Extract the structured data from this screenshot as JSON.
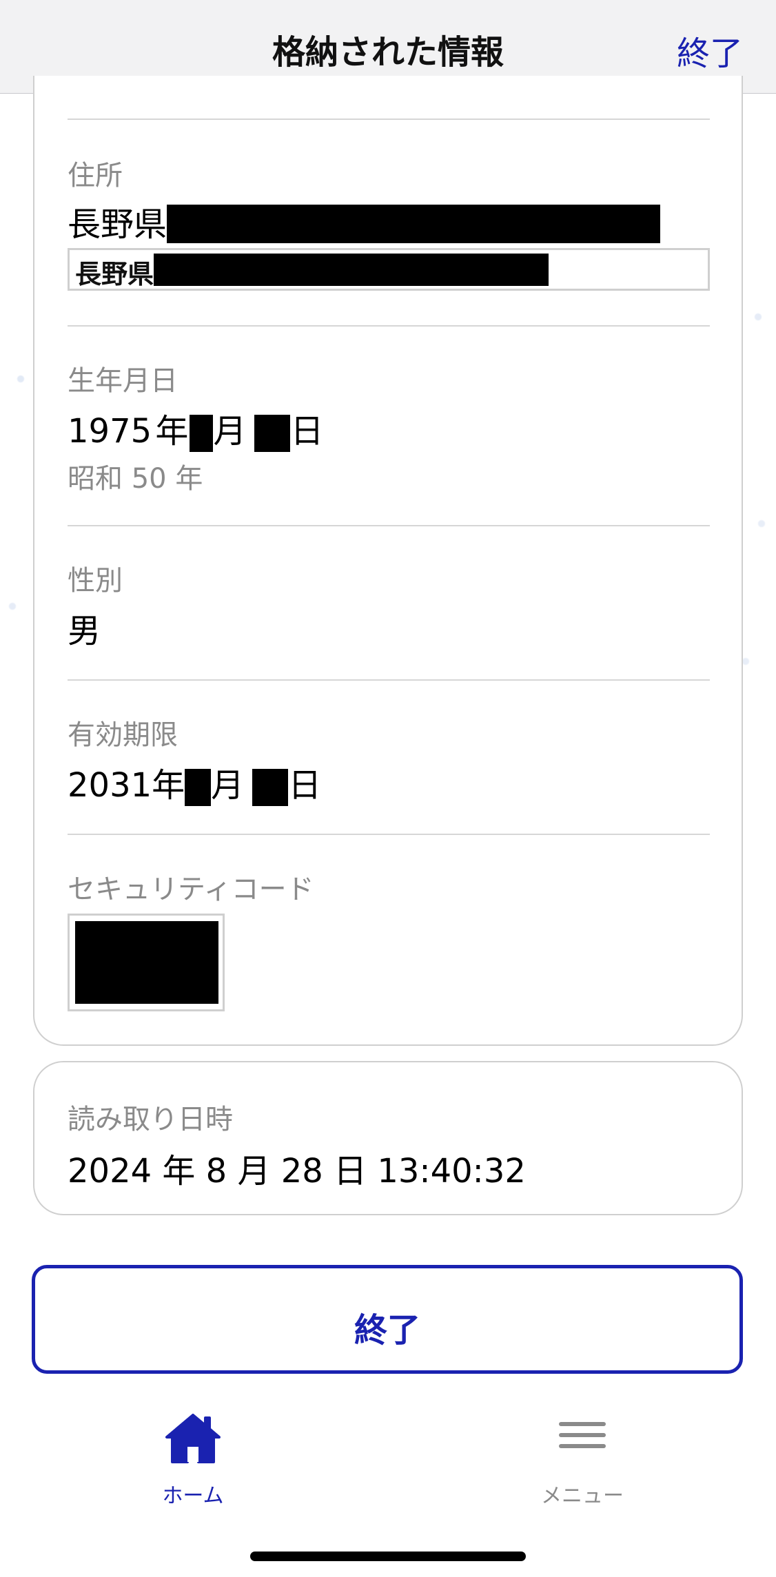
{
  "header": {
    "title": "格納された情報",
    "close_label": "終了"
  },
  "fields": {
    "address": {
      "label": "住所",
      "value_prefix": "長野県",
      "image_text": "長野県"
    },
    "birthdate": {
      "label": "生年月日",
      "year": "1975",
      "year_unit": "年",
      "month_unit": "月",
      "day_unit": "日",
      "era": "昭和 50 年"
    },
    "gender": {
      "label": "性別",
      "value": "男"
    },
    "expiry": {
      "label": "有効期限",
      "year": "2031",
      "year_unit": "年",
      "month_unit": "月",
      "day_unit": "日"
    },
    "security_code": {
      "label": "セキュリティコード"
    }
  },
  "read_info": {
    "label": "読み取り日時",
    "value": "2024 年 8 月 28 日 13:40:32"
  },
  "finish_button": {
    "label": "終了"
  },
  "tabbar": {
    "home_label": "ホーム",
    "menu_label": "メニュー"
  },
  "colors": {
    "accent": "#1a22b0",
    "label_gray": "#8a8a8a",
    "border": "#cfcfcf"
  }
}
